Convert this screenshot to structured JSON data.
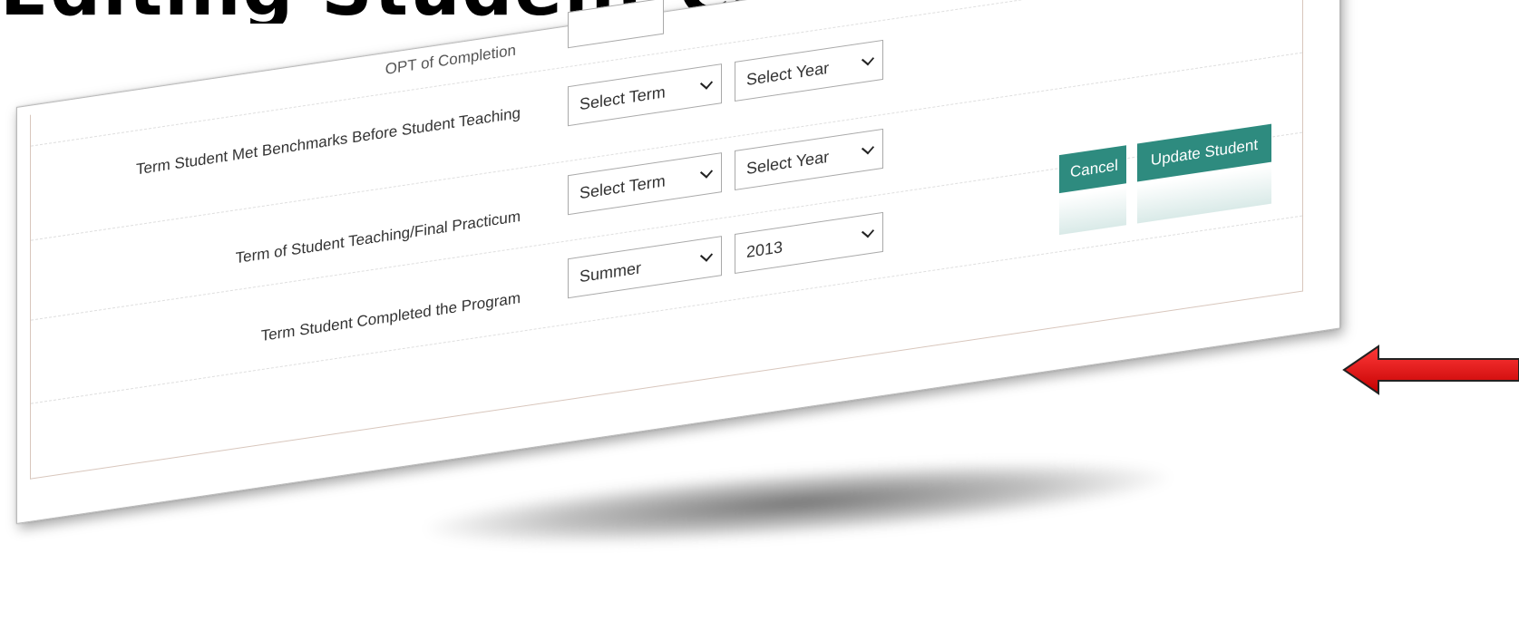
{
  "header": {
    "partial_heading": "Editing Student Completion"
  },
  "form": {
    "rows": [
      {
        "label": "Term Student Met Benchmarks Before Student Teaching",
        "term": "Select Term",
        "year": "Select Year"
      },
      {
        "label": "Term of Student Teaching/Final Practicum",
        "term": "Select Term",
        "year": "Select Year"
      },
      {
        "label": "Term Student Completed the Program",
        "term": "Summer",
        "year": "2013"
      }
    ],
    "partial_label": "OPT of Completion"
  },
  "actions": {
    "cancel_label": "Cancel",
    "update_label": "Update Student"
  },
  "colors": {
    "button": "#2e8b7f",
    "arrow": "#e01010"
  },
  "icons": {
    "select_chevron": "chevron-down-icon",
    "callout": "arrow-left-icon"
  }
}
